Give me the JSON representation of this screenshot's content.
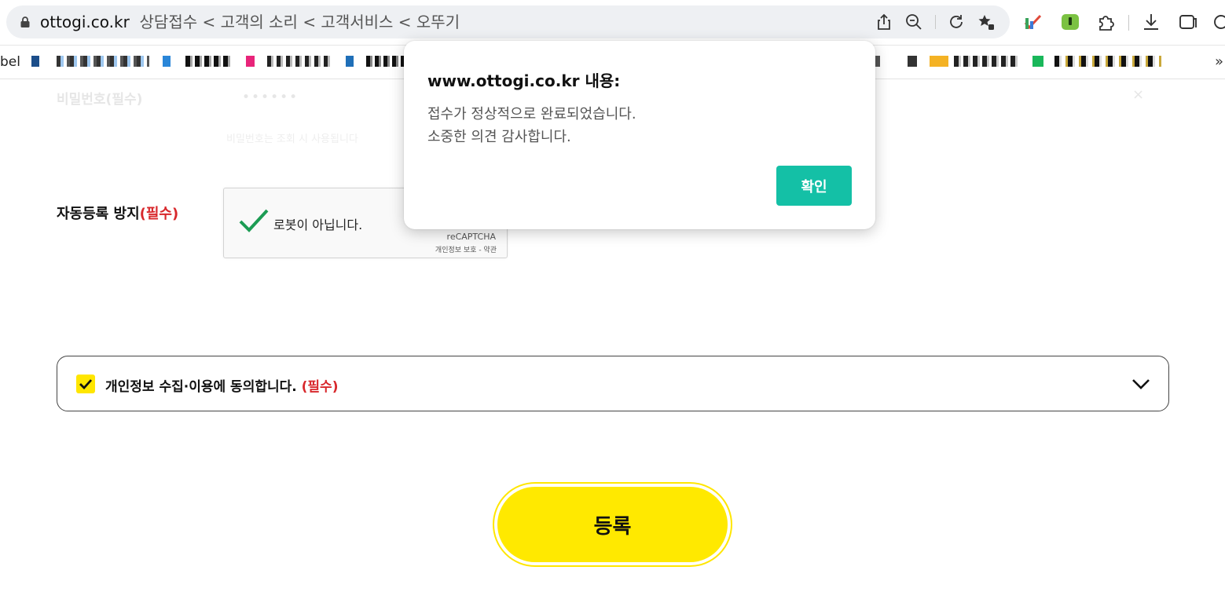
{
  "browser": {
    "url_host": "ottogi.co.kr",
    "url_path": "상담접수 < 고객의 소리 < 고객서비스 < 오뚜기",
    "bookmarks_label_fragment": "bel",
    "bookmarks_overflow": "»"
  },
  "background_form": {
    "password_label": "비밀번호(필수)",
    "password_dots": "••••••",
    "password_clear": "×",
    "password_note": "비밀번호는 조회 시 사용됩니다"
  },
  "antispam": {
    "label": "자동등록 방지",
    "required": "(필수)",
    "recaptcha_text": "로봇이 아닙니다.",
    "recaptcha_brand": "reCAPTCHA",
    "recaptcha_links": "개인정보 보호 - 약관"
  },
  "consent": {
    "label": "개인정보 수집·이용에 동의합니다.",
    "required": "(필수)"
  },
  "submit": {
    "label": "등록"
  },
  "dialog": {
    "title": "www.ottogi.co.kr 내용:",
    "message_line1": "접수가 정상적으로 완료되었습니다.",
    "message_line2": "소중한 의견 감사합니다.",
    "ok_label": "확인"
  },
  "colors": {
    "accent_yellow": "#ffe900",
    "ok_button": "#14c0a6",
    "required_red": "#d8282c",
    "recaptcha_green": "#1c9c54"
  }
}
